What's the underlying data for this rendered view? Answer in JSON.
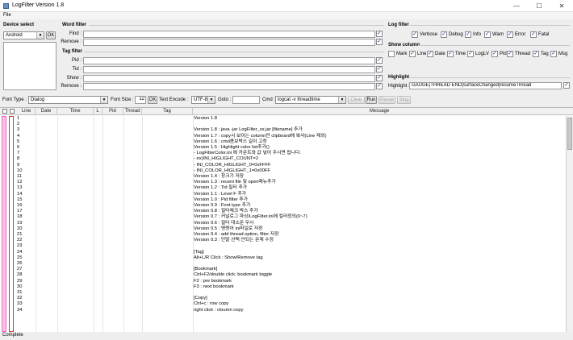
{
  "window": {
    "title": "LogFilter Version 1.8",
    "min": "—",
    "max": "☐",
    "close": "✕"
  },
  "menu": {
    "file": "File"
  },
  "device": {
    "title": "Device select",
    "selected": "Android",
    "ok": "OK"
  },
  "word_filter": {
    "title": "Word filter",
    "find_label": "Find :",
    "remove_label": "Remove :"
  },
  "tag_filter": {
    "title": "Tag filter",
    "pid_label": "Pid :",
    "tid_label": "Tid :",
    "show_label": "Show :",
    "remove_label": "Remove :"
  },
  "log_filter": {
    "title": "Log filter",
    "items": [
      {
        "label": "Verbose",
        "checked": true
      },
      {
        "label": "Debug",
        "checked": true
      },
      {
        "label": "Info",
        "checked": true
      },
      {
        "label": "Warn",
        "checked": true
      },
      {
        "label": "Error",
        "checked": true
      },
      {
        "label": "Fatal",
        "checked": true
      }
    ]
  },
  "show_column": {
    "title": "Show column",
    "items": [
      {
        "label": "Mark",
        "checked": false
      },
      {
        "label": "Line",
        "checked": true
      },
      {
        "label": "Date",
        "checked": true
      },
      {
        "label": "Time",
        "checked": true
      },
      {
        "label": "LogLV",
        "checked": true
      },
      {
        "label": "Pid",
        "checked": true
      },
      {
        "label": "Thread",
        "checked": true
      },
      {
        "label": "Tag",
        "checked": true
      },
      {
        "label": "Msg",
        "checked": true
      }
    ]
  },
  "highlight": {
    "title": "Highlight",
    "label": "Highlight :",
    "value": "GAUGE|THREAD END|surfaceChanged|resumeThread"
  },
  "toolbar": {
    "font_type_label": "Font Type :",
    "font_type_value": "Dialog",
    "font_size_label": "Font Size :",
    "font_size_value": "12",
    "ok": "OK",
    "text_encode_label": "Text Encode :",
    "text_encode_value": "UTF-8",
    "goto_label": "Goto :",
    "cmd_label": "Cmd :",
    "cmd_value": "logcat -v threadtime",
    "clear": "Clear",
    "run": "Run",
    "pause": "Pause",
    "stop": "Stop"
  },
  "table": {
    "headers": {
      "line": "Line",
      "date": "Date",
      "time": "Time",
      "loglv": "L",
      "pid": "Pid",
      "thread": "Thread",
      "tag": "Tag",
      "message": "Message"
    },
    "rows": [
      {
        "line": "1",
        "msg": "Version 1.8"
      },
      {
        "line": "2",
        "msg": ""
      },
      {
        "line": "3",
        "msg": "Version 1.8 : java -jar LogFilter_xx.jar [filename] 추가"
      },
      {
        "line": "4",
        "msg": "Version 1.7 : copy시 보이는 column만 clipboard에 복사(Line 제외)"
      },
      {
        "line": "5",
        "msg": "Version 1.6 : cmd콤보박스 길이 고정"
      },
      {
        "line": "6",
        "msg": "Version 1.5 : Highlight color list추가()"
      },
      {
        "line": "7",
        "msg": "   - LogFilterColor.ini 에 카운트와 값 넣어 주시면 됩니다."
      },
      {
        "line": "8",
        "msg": "   - ex)INI_HIGLIGHT_COUNT=2"
      },
      {
        "line": "9",
        "msg": "   -    INI_COLOR_HIGLIGHT_0=0xFFFF"
      },
      {
        "line": "10",
        "msg": "   -    INI_COLOR_HIGLIGHT_1=0x00FF"
      },
      {
        "line": "11",
        "msg": "Version 1.4 : 창크기 저장"
      },
      {
        "line": "12",
        "msg": "Version 1.3 : recent file 및 open메뉴추가"
      },
      {
        "line": "13",
        "msg": "Version 1.2 : Tid 필터 추가"
      },
      {
        "line": "14",
        "msg": "Version 1.1 : Level F 추가"
      },
      {
        "line": "15",
        "msg": "Version 1.0 : Pid filter 추가"
      },
      {
        "line": "16",
        "msg": "Version 0.9 : Font type 추가"
      },
      {
        "line": "17",
        "msg": "Version 0.8 : 필터체크 박스 추가"
      },
      {
        "line": "18",
        "msg": "Version 0.7 : 커널로그 파싱/LogFilter.ini에 컬러정의(0~7)"
      },
      {
        "line": "19",
        "msg": "Version 0.6 : 필터 대소문 무시"
      },
      {
        "line": "20",
        "msg": "Version 0.5 : 명령어 ini파일로 저장"
      },
      {
        "line": "21",
        "msg": "Version 0.4 : add thread option, filter 저장"
      },
      {
        "line": "22",
        "msg": "Version 0.3 : 단말 선택 안되는 문제 수정"
      },
      {
        "line": "23",
        "msg": ""
      },
      {
        "line": "24",
        "msg": "[Tag]"
      },
      {
        "line": "25",
        "msg": "Alt+L/R Click : Show/Remove tag"
      },
      {
        "line": "26",
        "msg": ""
      },
      {
        "line": "27",
        "msg": "[Bookmark]"
      },
      {
        "line": "28",
        "msg": "Ctrl+F2/double click: bookmark toggle"
      },
      {
        "line": "29",
        "msg": "F2 : pre bookmark"
      },
      {
        "line": "30",
        "msg": "F3 : next bookmark"
      },
      {
        "line": "31",
        "msg": ""
      },
      {
        "line": "32",
        "msg": "[Copy]"
      },
      {
        "line": "33",
        "msg": "Ctrl+c : row copy"
      },
      {
        "line": "34",
        "msg": "right click : cloumn copy"
      }
    ]
  },
  "status": {
    "text": "Complete"
  }
}
